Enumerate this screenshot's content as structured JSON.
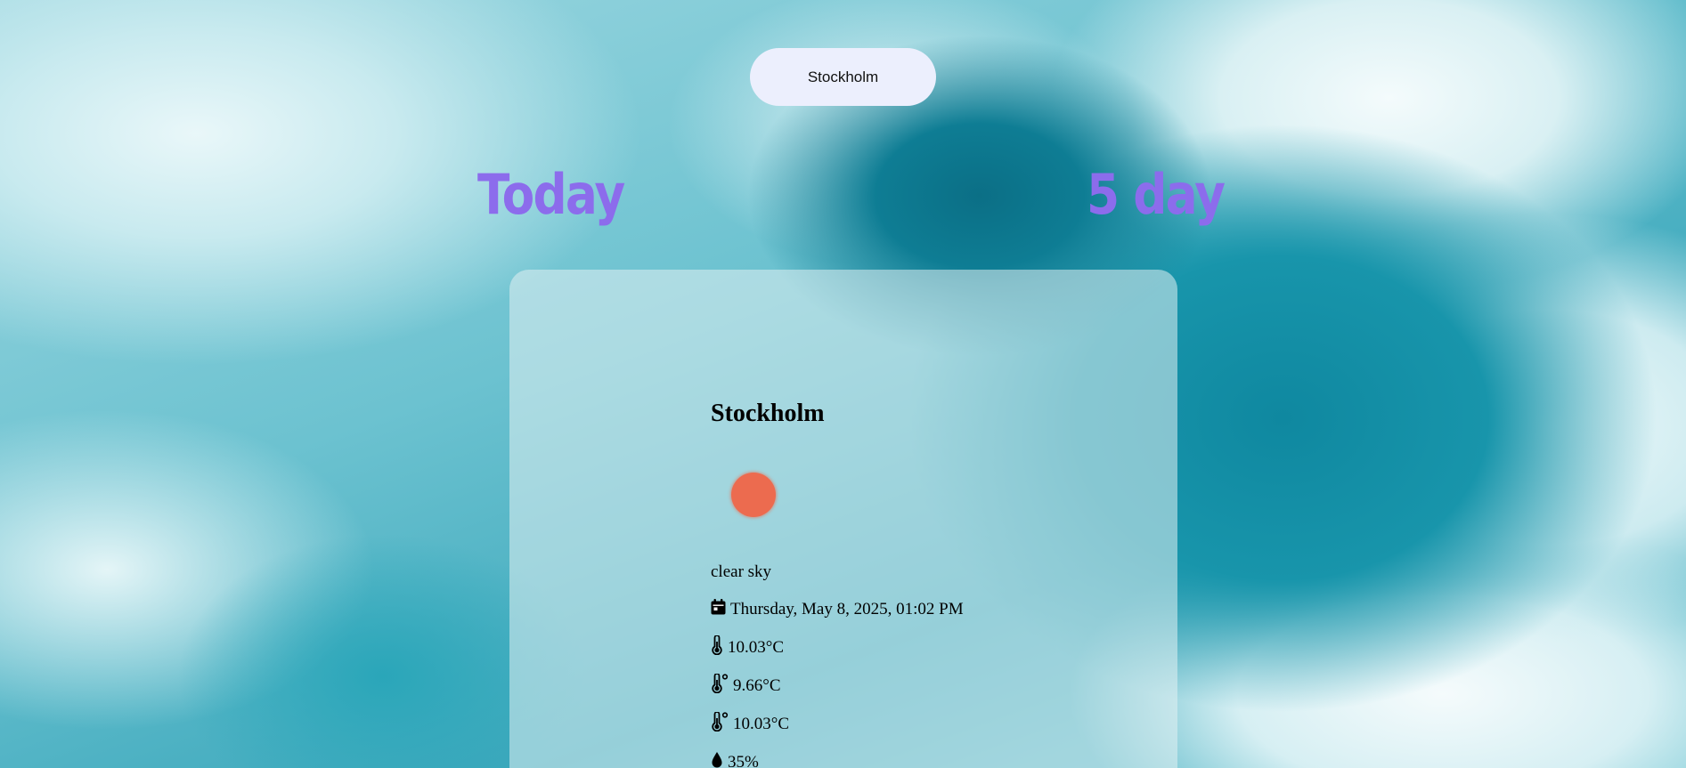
{
  "search": {
    "value": "Stockholm"
  },
  "tabs": {
    "today": "Today",
    "five_day": "5 day"
  },
  "current": {
    "city": "Stockholm",
    "description": "clear sky",
    "datetime": "Thursday, May 8, 2025, 01:02 PM",
    "temperature": "10.03°C",
    "feels_like": "9.66°C",
    "temp_max": "10.03°C",
    "humidity": "35%",
    "icon": "sun-icon"
  },
  "colors": {
    "tab_heading": "#8c6cec",
    "search_bg": "#eceffd",
    "sun": "#ec6b4f"
  }
}
